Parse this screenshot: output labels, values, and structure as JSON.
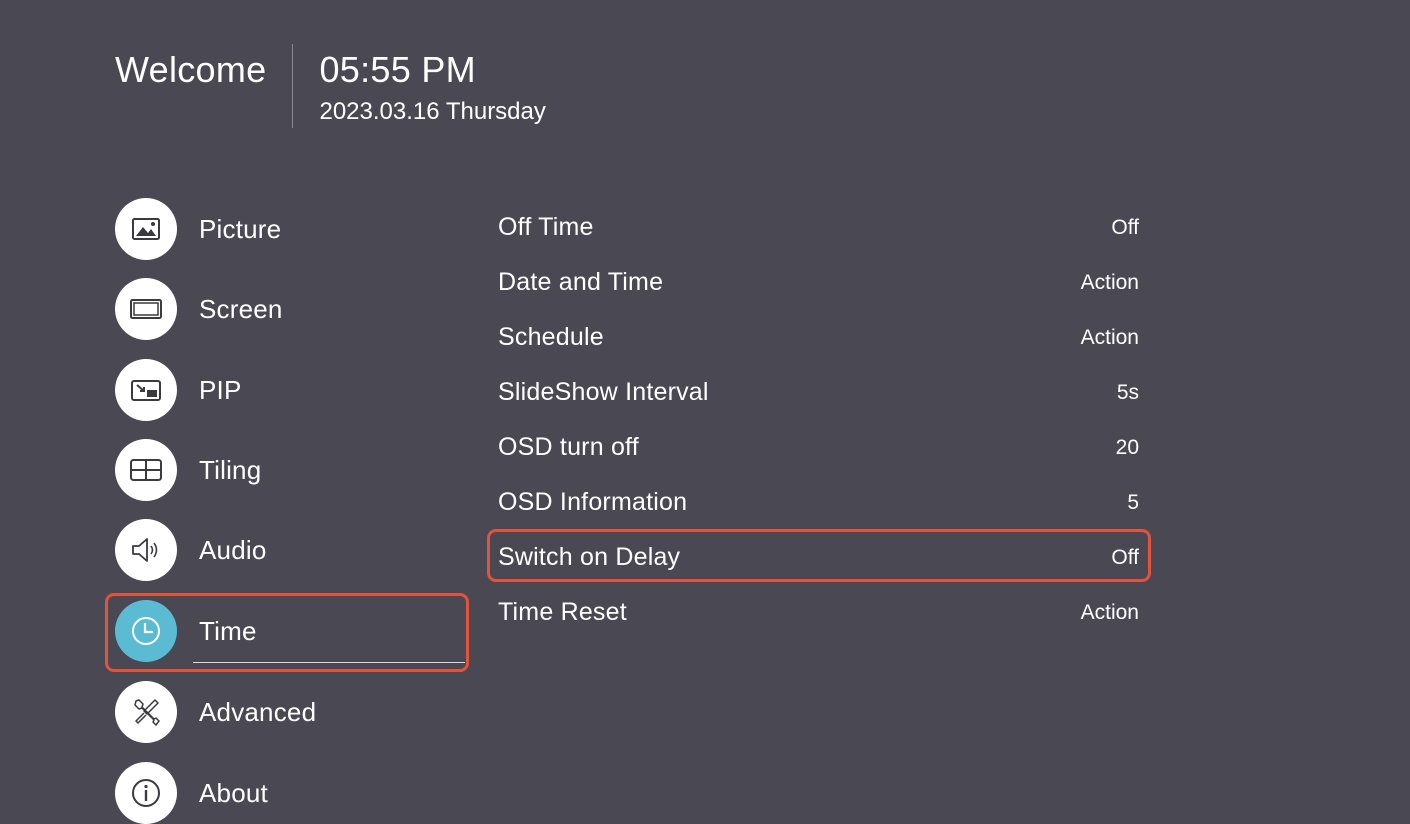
{
  "header": {
    "welcome": "Welcome",
    "time": "05:55 PM",
    "date": "2023.03.16 Thursday"
  },
  "menu": {
    "items": [
      {
        "label": "Picture",
        "icon": "picture-icon"
      },
      {
        "label": "Screen",
        "icon": "screen-icon"
      },
      {
        "label": "PIP",
        "icon": "pip-icon"
      },
      {
        "label": "Tiling",
        "icon": "tiling-icon"
      },
      {
        "label": "Audio",
        "icon": "audio-icon"
      },
      {
        "label": "Time",
        "icon": "clock-icon",
        "active": true
      },
      {
        "label": "Advanced",
        "icon": "tools-icon"
      },
      {
        "label": "About",
        "icon": "info-icon"
      }
    ]
  },
  "settings": {
    "rows": [
      {
        "label": "Off Time",
        "value": "Off"
      },
      {
        "label": "Date and Time",
        "value": "Action"
      },
      {
        "label": "Schedule",
        "value": "Action"
      },
      {
        "label": "SlideShow Interval",
        "value": "5s"
      },
      {
        "label": "OSD turn off",
        "value": "20"
      },
      {
        "label": "OSD Information",
        "value": "5"
      },
      {
        "label": "Switch on Delay",
        "value": "Off"
      },
      {
        "label": "Time Reset",
        "value": "Action"
      }
    ]
  },
  "colors": {
    "background": "#4a4853",
    "accent": "#5bbbd3",
    "highlight": "#e0543e",
    "text": "#ffffff"
  }
}
